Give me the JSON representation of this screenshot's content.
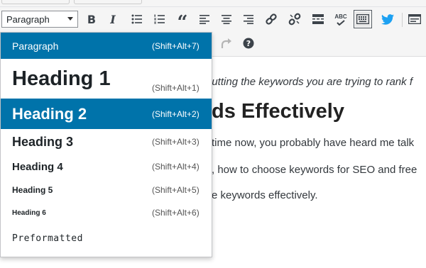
{
  "toolbar": {
    "format_select_value": "Paragraph",
    "format_select_icon": "triangle-down",
    "buttons": {
      "bold": "B",
      "italic": "I",
      "blockquote": "“"
    },
    "spellcheck_label": "ABC"
  },
  "format_menu": {
    "items": [
      {
        "label": "Paragraph",
        "shortcut": "(Shift+Alt+7)"
      },
      {
        "label": "Heading 1",
        "shortcut": "(Shift+Alt+1)"
      },
      {
        "label": "Heading 2",
        "shortcut": "(Shift+Alt+2)"
      },
      {
        "label": "Heading 3",
        "shortcut": "(Shift+Alt+3)"
      },
      {
        "label": "Heading 4",
        "shortcut": "(Shift+Alt+4)"
      },
      {
        "label": "Heading 5",
        "shortcut": "(Shift+Alt+5)"
      },
      {
        "label": "Heading 6",
        "shortcut": "(Shift+Alt+6)"
      },
      {
        "label": "Preformatted",
        "shortcut": ""
      }
    ],
    "selected": "Paragraph",
    "highlighted": "Heading 2"
  },
  "content": {
    "italic_line": "putting the keywords you are trying to rank f",
    "heading": "ds Effectively",
    "paragraph_1": "time now, you probably have heard me talk",
    "paragraph_2": ", how to choose keywords for SEO and free",
    "paragraph_3": "e keywords effectively."
  },
  "colors": {
    "accent": "#0073aa",
    "toolbar_bg": "#f5f5f5",
    "twitter_blue": "#1da1f2"
  }
}
